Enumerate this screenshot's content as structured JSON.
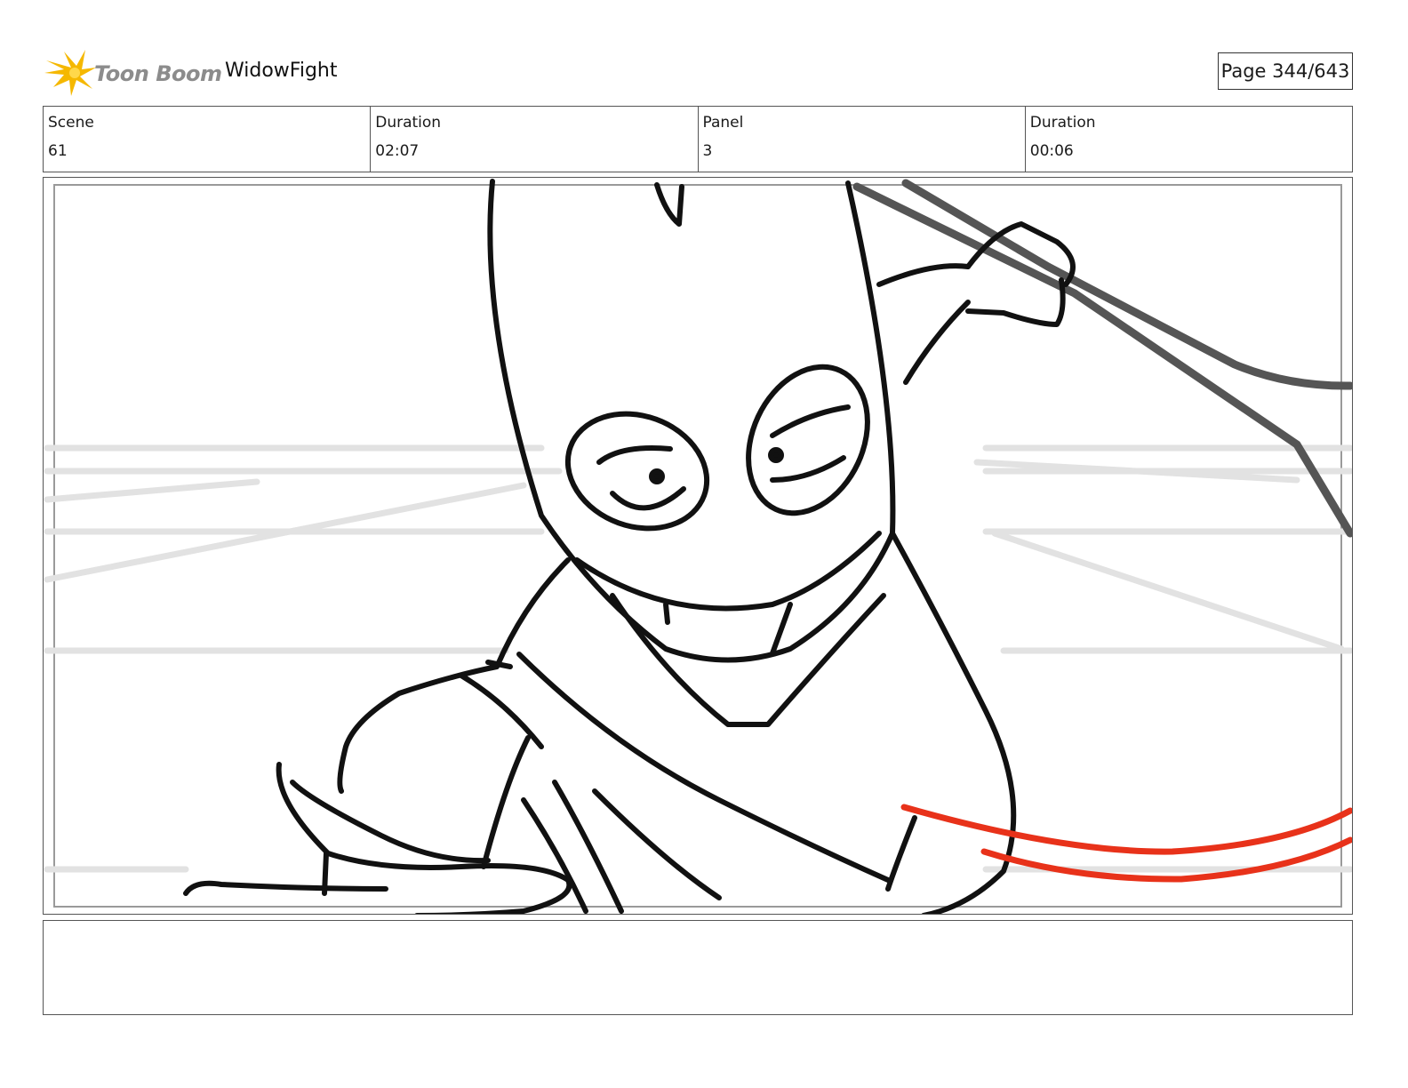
{
  "header": {
    "logo_text": "Toon Boom",
    "project_title": "WidowFight",
    "page_label": "Page 344/643"
  },
  "info": {
    "scene_label": "Scene",
    "scene_value": "61",
    "scene_duration_label": "Duration",
    "scene_duration_value": "02:07",
    "panel_label": "Panel",
    "panel_value": "3",
    "panel_duration_label": "Duration",
    "panel_duration_value": "00:06"
  },
  "notes": {
    "text": ""
  },
  "colors": {
    "logo_burst": "#f5b800",
    "sketch_ink": "#111111",
    "guide_lines": "#e2e2e2",
    "web_lines": "#e8321a"
  }
}
